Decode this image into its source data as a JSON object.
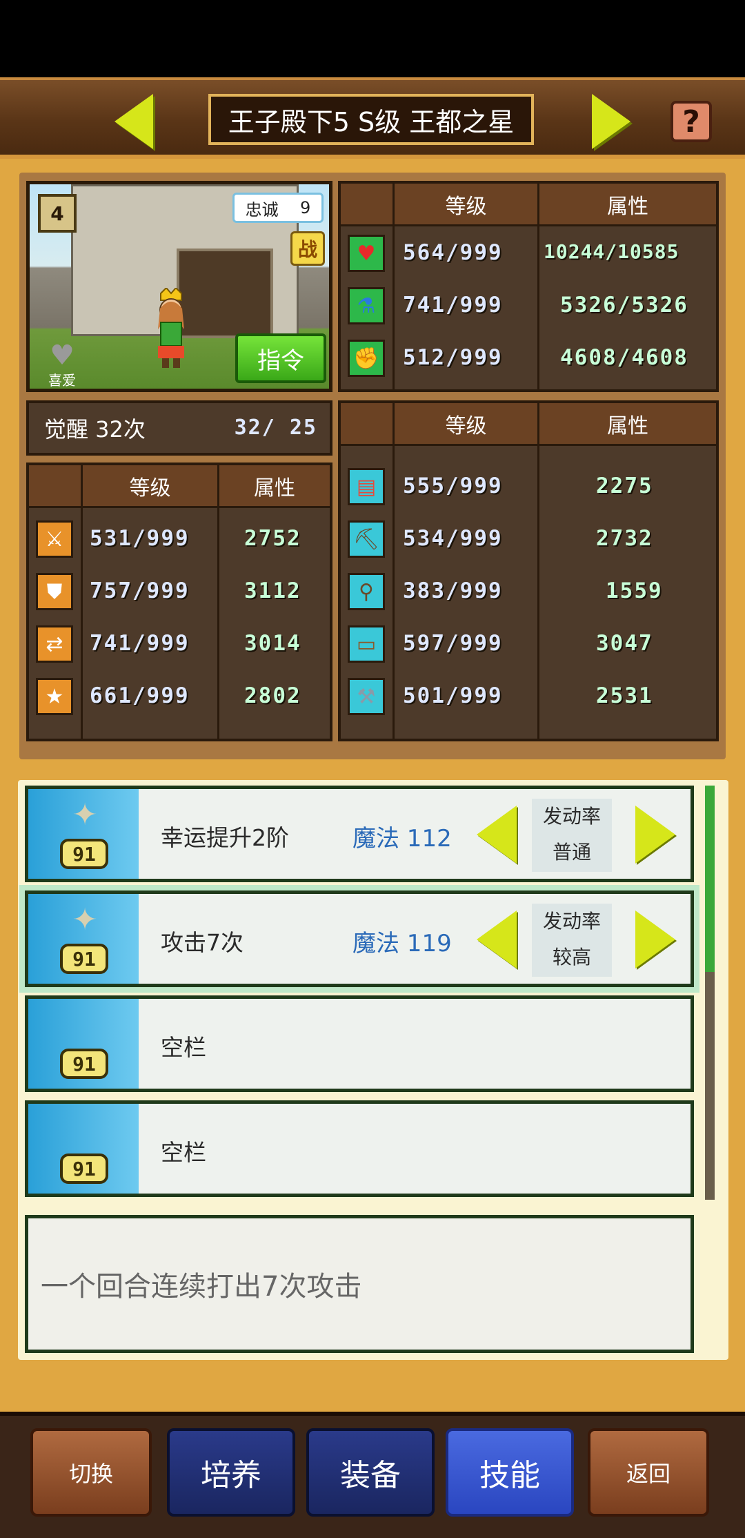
{
  "header": {
    "title": "王子殿下5 S级 王都之星",
    "help_label": "?"
  },
  "portrait": {
    "rank_badge": "4",
    "loyalty_label": "忠诚",
    "loyalty_value": "9",
    "battle_badge": "战",
    "favorite_label": "喜爱",
    "command_label": "指令"
  },
  "top_table": {
    "headers": [
      "等级",
      "属性"
    ],
    "rows": [
      {
        "icon": "heart-icon",
        "icon_bg": "#2db84a",
        "icon_char": "♥",
        "level": "564/999",
        "attr": "10244/10585"
      },
      {
        "icon": "potion-icon",
        "icon_bg": "#2db84a",
        "icon_char": "⚗",
        "level": "741/999",
        "attr": "5326/5326"
      },
      {
        "icon": "muscle-icon",
        "icon_bg": "#2db84a",
        "icon_char": "💪",
        "level": "512/999",
        "attr": "4608/4608"
      }
    ]
  },
  "awaken": {
    "label": "觉醒 32次",
    "value": "32/ 25"
  },
  "left_table": {
    "headers": [
      "等级",
      "属性"
    ],
    "rows": [
      {
        "icon": "sword-icon",
        "level": "531/999",
        "attr": "2752"
      },
      {
        "icon": "shield-icon",
        "level": "757/999",
        "attr": "3112"
      },
      {
        "icon": "arrows-icon",
        "level": "741/999",
        "attr": "3014"
      },
      {
        "icon": "star-icon",
        "level": "661/999",
        "attr": "2802"
      }
    ]
  },
  "right_table": {
    "headers": [
      "等级",
      "属性"
    ],
    "rows": [
      {
        "icon": "book-icon",
        "level": "555/999",
        "attr": "2275"
      },
      {
        "icon": "pickaxe-icon",
        "level": "534/999",
        "attr": "2732"
      },
      {
        "icon": "shovel-icon",
        "level": "383/999",
        "attr": "1559"
      },
      {
        "icon": "chest-icon",
        "level": "597/999",
        "attr": "3047"
      },
      {
        "icon": "hammer-icon",
        "level": "501/999",
        "attr": "2531"
      }
    ]
  },
  "skills": [
    {
      "level": "91",
      "name": "幸运提升2阶",
      "magic": "魔法 112",
      "rate_label": "发动率",
      "rate_value": "普通"
    },
    {
      "level": "91",
      "name": "攻击7次",
      "magic": "魔法 119",
      "rate_label": "发动率",
      "rate_value": "较高"
    },
    {
      "level": "91",
      "name": "空栏"
    },
    {
      "level": "91",
      "name": "空栏"
    }
  ],
  "description": "一个回合连续打出7次攻击",
  "bottom_nav": {
    "switch": "切换",
    "train": "培养",
    "equip": "装备",
    "skills": "技能",
    "back": "返回"
  }
}
